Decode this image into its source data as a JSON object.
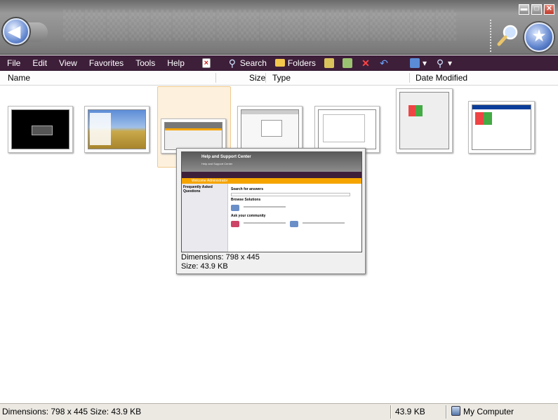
{
  "window": {
    "buttons": {
      "minimize": "▬",
      "maximize": "□",
      "close": "✕"
    }
  },
  "menubar": {
    "items": [
      "File",
      "Edit",
      "View",
      "Favorites",
      "Tools",
      "Help"
    ],
    "search_label": "Search",
    "folders_label": "Folders"
  },
  "columns": {
    "name": "Name",
    "size": "Size",
    "type": "Type",
    "date_modified": "Date Modified"
  },
  "tooltip": {
    "dimensions": "Dimensions: 798 x 445",
    "size": "Size: 43.9 KB",
    "preview": {
      "title": "Help and Support Center",
      "subtitle": "Help and Support Center",
      "welcome": "Welcome Administrator",
      "left_heading": "Frequently Asked Questions",
      "search_heading": "Search for answers",
      "browse_heading": "Browse Solutions",
      "community_heading": "Ask your community"
    }
  },
  "status": {
    "details": "Dimensions: 798 x 445 Size: 43.9 KB",
    "size": "43.9 KB",
    "location": "My Computer"
  },
  "colors": {
    "menubar": "#3e1f3a",
    "header": "#8c8c8c",
    "highlight": "#fdf1de",
    "accent_bar": "#f5a400"
  }
}
